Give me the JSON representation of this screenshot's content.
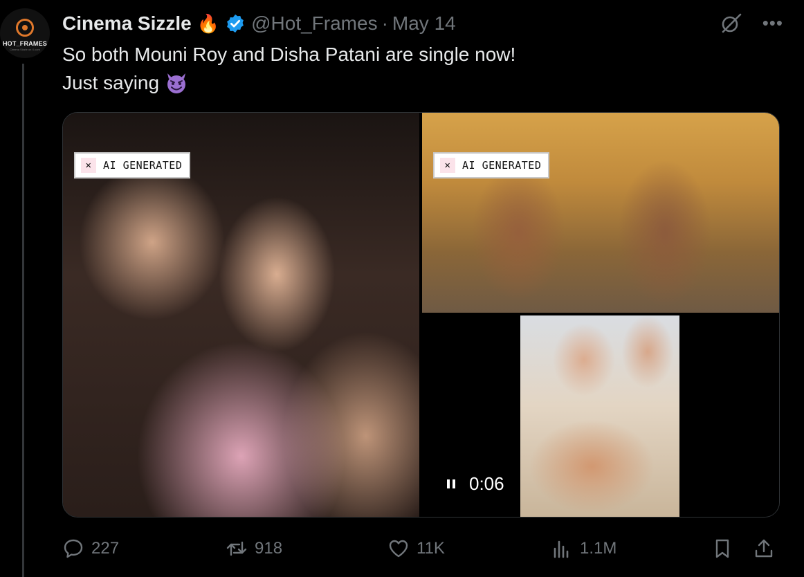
{
  "avatar": {
    "brand": "HOT_FRAMES",
    "brand_sub": "Cinema Sizzle on X.com"
  },
  "post": {
    "display_name": "Cinema Sizzle",
    "name_emoji": "🔥",
    "handle": "@Hot_Frames",
    "separator": "·",
    "date": "May 14",
    "text": "So both Mouni Roy and Disha Patani are single now!\nJust saying",
    "text_emoji_icon": "smiling-devil-icon",
    "verified_color": "#1d9bf0",
    "accent_color": "#e0782b"
  },
  "media": {
    "badge_label": "AI GENERATED",
    "video_time": "0:06"
  },
  "actions": {
    "replies": "227",
    "reposts": "918",
    "likes": "11K",
    "views": "1.1M"
  },
  "icons": [
    "grok-icon",
    "more-icon",
    "verified-icon",
    "fire-icon",
    "reply-icon",
    "repost-icon",
    "like-icon",
    "views-icon",
    "bookmark-icon",
    "share-icon",
    "pause-icon"
  ]
}
